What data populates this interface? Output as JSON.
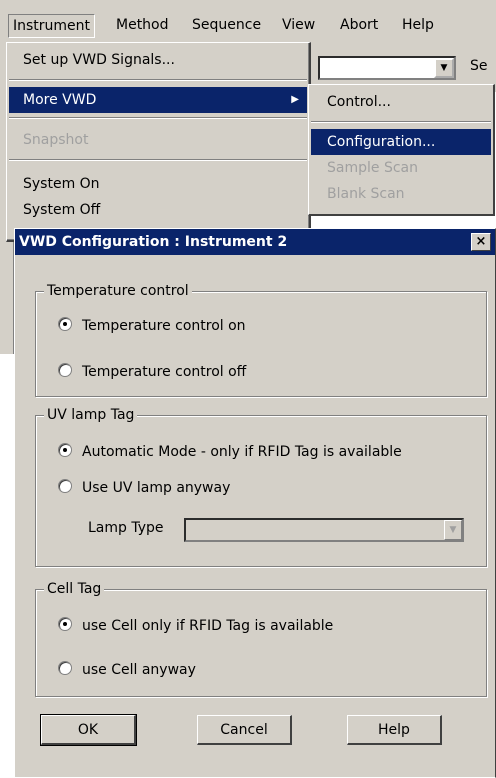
{
  "menubar": {
    "items": [
      "Instrument",
      "Method",
      "Sequence",
      "View",
      "Abort",
      "Help"
    ]
  },
  "toolbar": {
    "se_label": "Se"
  },
  "menu": {
    "setup_vwd": "Set up VWD  Signals...",
    "more_vwd": "More VWD",
    "snapshot": "Snapshot",
    "system_on": "System On",
    "system_off": "System Off"
  },
  "submenu": {
    "control": "Control...",
    "configuration": "Configuration...",
    "sample_scan": "Sample Scan",
    "blank_scan": "Blank Scan"
  },
  "dialog": {
    "title": "VWD Configuration : Instrument 2",
    "close": "×",
    "temperature": {
      "legend": "Temperature control",
      "on": "Temperature control on",
      "off": "Temperature control off",
      "selected": "on"
    },
    "uv_lamp": {
      "legend": "UV lamp Tag",
      "auto": "Automatic Mode  -  only if RFID Tag is available",
      "anyway": "Use UV lamp anyway",
      "lamp_type_label": "Lamp Type",
      "lamp_type_value": "",
      "selected": "auto"
    },
    "cell": {
      "legend": "Cell Tag",
      "rfid": "use Cell only if RFID Tag is available",
      "anyway": "use Cell anyway",
      "selected": "rfid"
    },
    "buttons": {
      "ok": "OK",
      "cancel": "Cancel",
      "help": "Help"
    }
  },
  "colors": {
    "face": "#d4d0c8",
    "highlight": "#0a246a",
    "disabled": "#a0a0a0"
  }
}
